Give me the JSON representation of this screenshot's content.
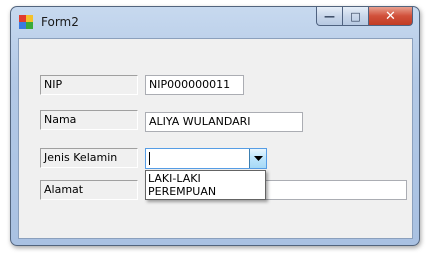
{
  "window": {
    "title": "Form2"
  },
  "caption": {
    "minimize": "—",
    "maximize": "□",
    "close": "✕"
  },
  "form": {
    "nip": {
      "label": "NIP",
      "value": "NIP000000011"
    },
    "nama": {
      "label": "Nama",
      "value": "ALIYA WULANDARI"
    },
    "jenis_kelamin": {
      "label": "Jenis Kelamin",
      "value": "",
      "options": [
        "LAKI-LAKI",
        "PEREMPUAN"
      ]
    },
    "alamat": {
      "label": "Alamat",
      "value": ""
    }
  }
}
